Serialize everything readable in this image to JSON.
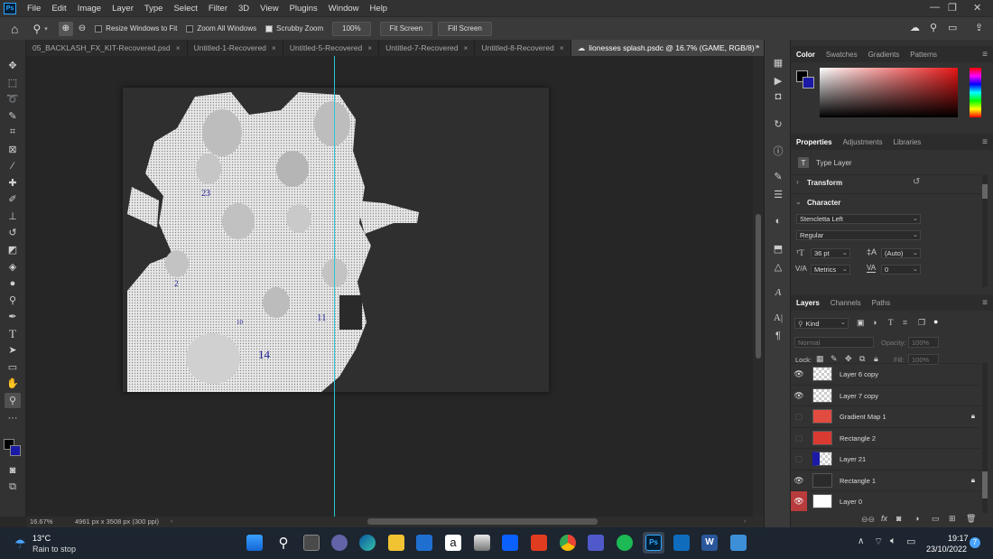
{
  "app": {
    "logo": "Ps",
    "menu": [
      "File",
      "Edit",
      "Image",
      "Layer",
      "Type",
      "Select",
      "Filter",
      "3D",
      "View",
      "Plugins",
      "Window",
      "Help"
    ]
  },
  "options_bar": {
    "resize_windows": "Resize Windows to Fit",
    "zoom_all_windows": "Zoom All Windows",
    "scrubby_zoom": "Scrubby Zoom",
    "zoom_value": "100%",
    "fit_screen": "Fit Screen",
    "fill_screen": "Fill Screen"
  },
  "tabs": [
    {
      "label": "05_BACKLASH_FX_KIT-Recovered.psd"
    },
    {
      "label": "Untitled-1-Recovered"
    },
    {
      "label": "Untitled-5-Recovered"
    },
    {
      "label": "Untitled-7-Recovered"
    },
    {
      "label": "Untitled-8-Recovered"
    },
    {
      "label": "lionesses splash.psdc @ 16.7% (GAME, RGB/8) *"
    }
  ],
  "status": {
    "zoom": "16.67%",
    "doc_size": "4961 px x 3508 px (300 ppi)"
  },
  "color_panel": {
    "tabs": [
      "Color",
      "Swatches",
      "Gradients",
      "Patterns"
    ],
    "foreground": "#000000",
    "background": "#1a1aa6",
    "hue_color": "#e81616"
  },
  "properties_panel": {
    "tabs": [
      "Properties",
      "Adjustments",
      "Libraries"
    ],
    "layer_type": "Type Layer",
    "transform_label": "Transform",
    "character_label": "Character",
    "font_family": "Stencletta Left",
    "font_style": "Regular",
    "font_size": "36 pt",
    "leading": "(Auto)",
    "kerning": "Metrics",
    "tracking": "0"
  },
  "layers_panel": {
    "tabs": [
      "Layers",
      "Channels",
      "Paths"
    ],
    "filter_kind": "Kind",
    "blend_mode": "Normal",
    "opacity_label": "Opacity:",
    "opacity_value": "100%",
    "lock_label": "Lock:",
    "fill_label": "Fill:",
    "fill_value": "100%",
    "layers": [
      {
        "name": "Layer 6 copy",
        "visible": true,
        "thumb": "checker",
        "locked": false
      },
      {
        "name": "Layer 7 copy",
        "visible": true,
        "thumb": "checker",
        "locked": false
      },
      {
        "name": "Gradient Map 1",
        "visible": false,
        "thumb": "red",
        "locked": true
      },
      {
        "name": "Rectangle 2",
        "visible": false,
        "thumb": "redrect",
        "locked": false
      },
      {
        "name": "Layer 21",
        "visible": false,
        "thumb": "bluechecker",
        "locked": false
      },
      {
        "name": "Rectangle 1",
        "visible": true,
        "thumb": "darkrect",
        "locked": true
      },
      {
        "name": "Layer 0",
        "visible": true,
        "thumb": "white",
        "locked": false,
        "selected_eye": true
      }
    ]
  },
  "taskbar": {
    "temperature": "13°C",
    "weather": "Rain to stop",
    "time": "19:17",
    "date": "23/10/2022",
    "notifications": "7"
  }
}
